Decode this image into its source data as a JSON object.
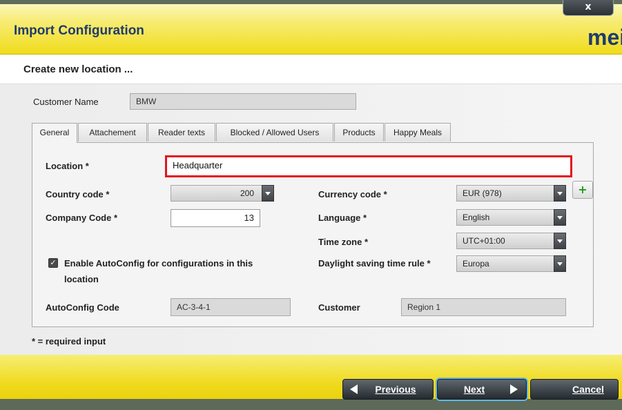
{
  "window": {
    "title": "Import Configuration",
    "close_label": "x",
    "logo_text": "mei",
    "subtitle": "Create new location ..."
  },
  "customer": {
    "label": "Customer Name",
    "value": "BMW"
  },
  "tabs": [
    {
      "label": "General",
      "active": true
    },
    {
      "label": "Attachement",
      "active": false
    },
    {
      "label": "Reader texts",
      "active": false
    },
    {
      "label": "Blocked / Allowed Users",
      "active": false
    },
    {
      "label": "Products",
      "active": false
    },
    {
      "label": "Happy Meals",
      "active": false
    }
  ],
  "general": {
    "location_label": "Location *",
    "location_value": "Headquarter",
    "country_label": "Country code *",
    "country_value": "200",
    "company_label": "Company Code *",
    "company_value": "13",
    "currency_label": "Currency code *",
    "currency_value": "EUR (978)",
    "language_label": "Language *",
    "language_value": "English",
    "timezone_label": "Time zone *",
    "timezone_value": "UTC+01:00",
    "autoconfig_check_label_line1": "Enable AutoConfig for configurations in this",
    "autoconfig_check_label_line2": "location",
    "autoconfig_checked": true,
    "dst_label": "Daylight saving time rule *",
    "dst_value": "Europa",
    "autoconfig_code_label": "AutoConfig Code",
    "autoconfig_code_value": "AC-3-4-1",
    "customer_label": "Customer",
    "customer_value": "Region 1",
    "add_label": "+"
  },
  "footer_note": "* = required input",
  "buttons": {
    "previous": "Previous",
    "next": "Next",
    "cancel": "Cancel"
  }
}
